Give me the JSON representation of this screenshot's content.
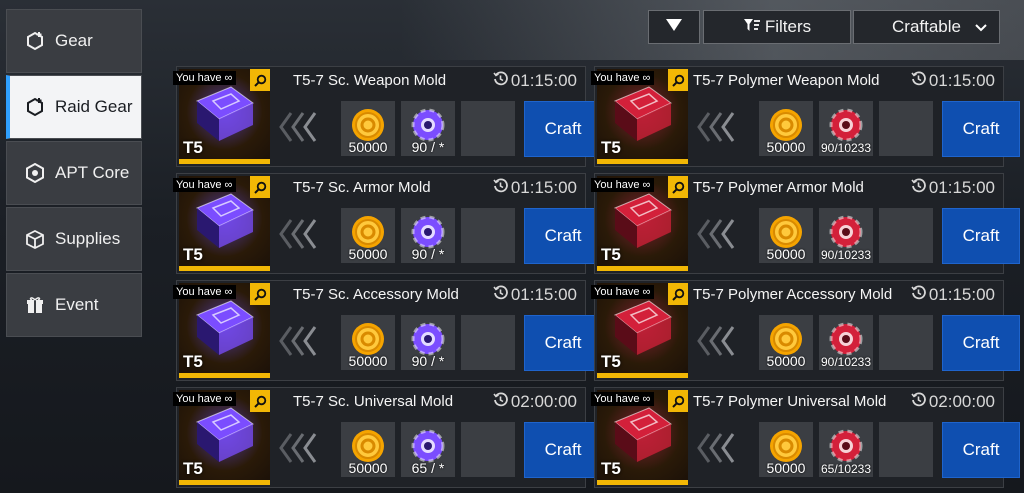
{
  "sidebar": {
    "items": [
      {
        "label": "Gear",
        "icon": "gear-plus-icon",
        "active": false
      },
      {
        "label": "Raid Gear",
        "icon": "gear-plus-icon",
        "active": true
      },
      {
        "label": "APT Core",
        "icon": "hexagon-core-icon",
        "active": false
      },
      {
        "label": "Supplies",
        "icon": "box-icon",
        "active": false
      },
      {
        "label": "Event",
        "icon": "gift-icon",
        "active": false
      }
    ]
  },
  "toolbar": {
    "filters_label": "Filters",
    "sort_value": "Craftable"
  },
  "cards": [
    {
      "title": "T5-7 Sc. Weapon Mold",
      "timer": "01:15:00",
      "have": "You have ∞",
      "tier": "T5",
      "credits": "50000",
      "mat": "90 / *",
      "craft": "Craft",
      "type": "sc"
    },
    {
      "title": "T5-7 Polymer Weapon Mold",
      "timer": "01:15:00",
      "have": "You have ∞",
      "tier": "T5",
      "credits": "50000",
      "mat": "90/10233",
      "craft": "Craft",
      "type": "poly"
    },
    {
      "title": "T5-7 Sc. Armor Mold",
      "timer": "01:15:00",
      "have": "You have ∞",
      "tier": "T5",
      "credits": "50000",
      "mat": "90 / *",
      "craft": "Craft",
      "type": "sc"
    },
    {
      "title": "T5-7 Polymer Armor Mold",
      "timer": "01:15:00",
      "have": "You have ∞",
      "tier": "T5",
      "credits": "50000",
      "mat": "90/10233",
      "craft": "Craft",
      "type": "poly"
    },
    {
      "title": "T5-7 Sc. Accessory Mold",
      "timer": "01:15:00",
      "have": "You have ∞",
      "tier": "T5",
      "credits": "50000",
      "mat": "90 / *",
      "craft": "Craft",
      "type": "sc"
    },
    {
      "title": "T5-7 Polymer Accessory Mold",
      "timer": "01:15:00",
      "have": "You have ∞",
      "tier": "T5",
      "credits": "50000",
      "mat": "90/10233",
      "craft": "Craft",
      "type": "poly"
    },
    {
      "title": "T5-7 Sc. Universal Mold",
      "timer": "02:00:00",
      "have": "You have ∞",
      "tier": "T5",
      "credits": "50000",
      "mat": "65 / *",
      "craft": "Craft",
      "type": "sc"
    },
    {
      "title": "T5-7 Polymer Universal Mold",
      "timer": "02:00:00",
      "have": "You have ∞",
      "tier": "T5",
      "credits": "50000",
      "mat": "65/10233",
      "craft": "Craft",
      "type": "poly"
    }
  ],
  "colors": {
    "accent_blue": "#0f4fb0",
    "active_tab_indicator": "#2fa0ff",
    "tier_yellow": "#f2b705",
    "sc_purple": "#7b4dff",
    "poly_red": "#d3203a"
  }
}
